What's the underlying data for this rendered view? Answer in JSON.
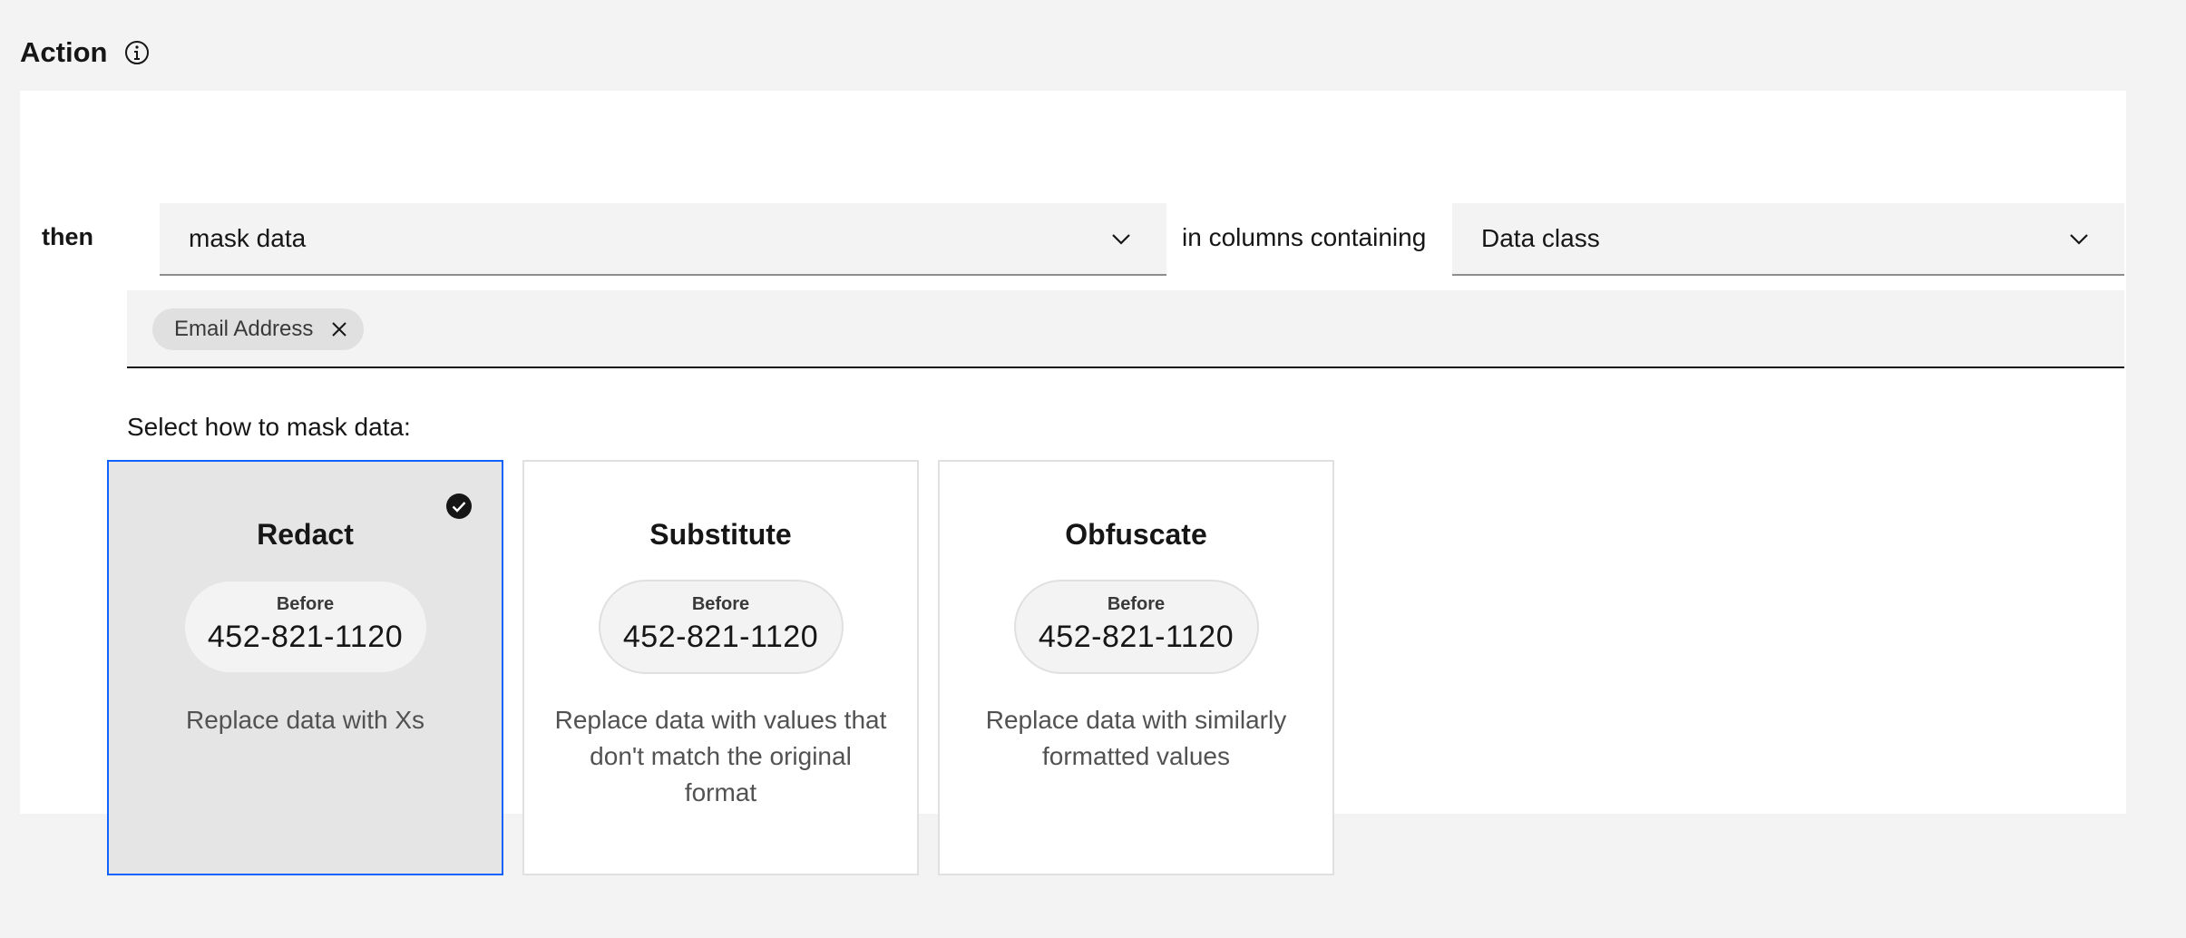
{
  "header": {
    "title": "Action",
    "info_icon": "info-icon"
  },
  "rule": {
    "then_label": "then",
    "action_select": {
      "value": "mask data",
      "icon": "chevron-down-icon"
    },
    "connector_text": "in columns containing",
    "column_select": {
      "value": "Data class",
      "icon": "chevron-down-icon"
    },
    "tags": [
      {
        "label": "Email Address",
        "remove_icon": "close-icon"
      }
    ]
  },
  "masking": {
    "prompt": "Select how to mask data:",
    "options": [
      {
        "title": "Redact",
        "before_label": "Before",
        "sample": "452-821-1120",
        "description": "Replace data with Xs",
        "selected": true
      },
      {
        "title": "Substitute",
        "before_label": "Before",
        "sample": "452-821-1120",
        "description": "Replace data with values that don't match the original format",
        "selected": false
      },
      {
        "title": "Obfuscate",
        "before_label": "Before",
        "sample": "452-821-1120",
        "description": "Replace data with similarly formatted values",
        "selected": false
      }
    ]
  },
  "colors": {
    "accent": "#0f62fe",
    "page_bg": "#f3f3f3",
    "panel_bg": "#ffffff",
    "selected_card_bg": "#e5e5e5"
  }
}
